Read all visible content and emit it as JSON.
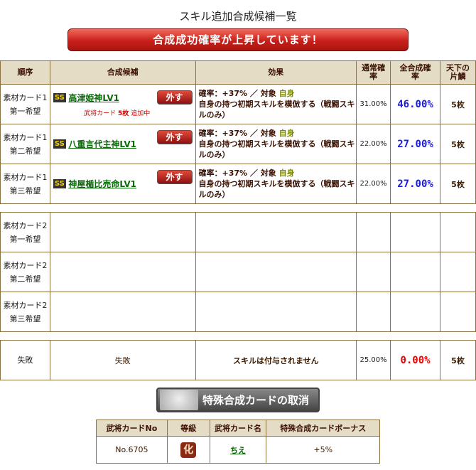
{
  "title": "スキル追加合成候補一覧",
  "banner": "合成成功確率が上昇しています！",
  "headers": [
    "順序",
    "合成候補",
    "効果",
    "通常確率",
    "全合成確率",
    "天下の片鱗"
  ],
  "rows": [
    {
      "order1": "素材カード1",
      "order2": "第一希望",
      "badge": "SS",
      "name": "高津姫神LV1",
      "remove": "外す",
      "note_pre": "武将カード",
      "note_count": "5枚",
      "note_post": "追加中",
      "eff_rate": "確率：+37% ／ 対象",
      "eff_target": "自身",
      "eff_desc": "自身の持つ初期スキルを模倣する（戦闘スキルのみ）",
      "normal": "31.00%",
      "total": "46.00%",
      "count": "5枚"
    },
    {
      "order1": "素材カード1",
      "order2": "第二希望",
      "badge": "SS",
      "name": "八重言代主神LV1",
      "remove": "外す",
      "eff_rate": "確率：+37% ／ 対象",
      "eff_target": "自身",
      "eff_desc": "自身の持つ初期スキルを模倣する（戦闘スキルのみ）",
      "normal": "22.00%",
      "total": "27.00%",
      "count": "5枚"
    },
    {
      "order1": "素材カード1",
      "order2": "第三希望",
      "badge": "SS",
      "name": "神屋楯比売命LV1",
      "remove": "外す",
      "eff_rate": "確率：+37% ／ 対象",
      "eff_target": "自身",
      "eff_desc": "自身の持つ初期スキルを模倣する（戦闘スキルのみ）",
      "normal": "22.00%",
      "total": "27.00%",
      "count": "5枚"
    }
  ],
  "empty_rows": [
    {
      "order1": "素材カード2",
      "order2": "第一希望"
    },
    {
      "order1": "素材カード2",
      "order2": "第二希望"
    },
    {
      "order1": "素材カード2",
      "order2": "第三希望"
    }
  ],
  "fail": {
    "order": "失敗",
    "cand": "失敗",
    "eff": "スキルは付与されません",
    "normal": "25.00%",
    "total": "0.00%",
    "count": "5枚"
  },
  "cancel_button": "特殊合成カードの取消",
  "sub": {
    "headers": [
      "武将カードNo",
      "等級",
      "武将カード名",
      "特殊合成カードボーナス"
    ],
    "no": "No.6705",
    "rank": "化",
    "name": "ちえ",
    "bonus": "+5%"
  }
}
